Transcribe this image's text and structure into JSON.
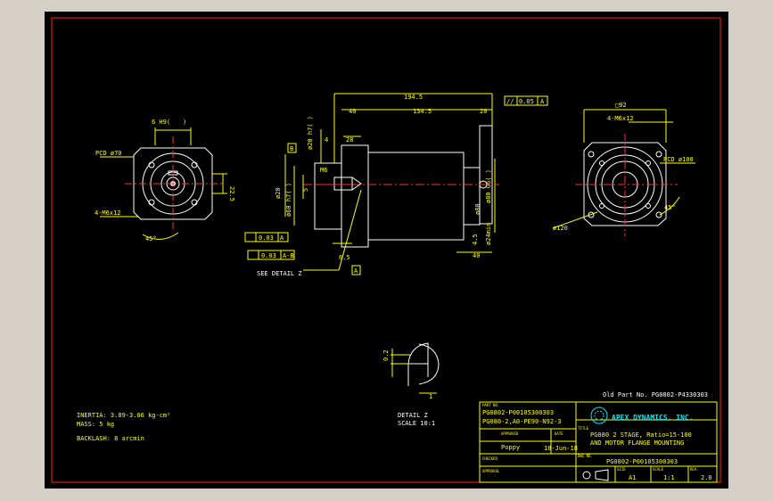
{
  "colors": {
    "background": "#000000",
    "frame": "#ff2020",
    "geometry": "#ffffff",
    "dimension": "#ffff00",
    "center": "#ff3030",
    "accent": "#00e5ff",
    "window": "#d4d0c8"
  },
  "left_view": {
    "keyway": "6 H9(",
    "keyway_b": ")",
    "pcd": "PCD ø70",
    "tap": "4-M6x12",
    "angle": "45°",
    "dim_25": "22.5"
  },
  "mid_view": {
    "len_total": "194.5",
    "len_40": "40",
    "len_134": "134.5",
    "len_20": "20",
    "len_4": "4",
    "len_28": "28",
    "len_65": "6.5",
    "len_40b": "40",
    "shaft_top": "ø20 h7(  )",
    "m6": "M6",
    "flange_60": "ø60 h7(  )",
    "shaft_20": "ø20",
    "d_5": "5",
    "d_80a": "ø80",
    "d_80b": "ø80 G6(  )",
    "d_24": "ø24min",
    "d_415": "4.5",
    "datum_b": "B",
    "datum_a": "A",
    "gdt_par_sym": "//",
    "gdt_par_val": "0.05",
    "gdt_par_ref": "A",
    "gdt_a_val": "0.03",
    "gdt_a_ref": "A",
    "gdt_ab_val": "0.03",
    "gdt_ab_ref": "A-B",
    "see_detail": "SEE DETAIL Z"
  },
  "right_view": {
    "sq": "□92",
    "tap": "4-M6x12",
    "pcd": "PCD ø100",
    "dia": "ø120",
    "angle": "45°"
  },
  "detail": {
    "d02": "0.2",
    "d1": "1",
    "title": "DETAIL Z",
    "scale": "SCALE 10:1"
  },
  "notes": {
    "inertia": "INERTIA: 3.89-3.06 kg-cm²",
    "mass": "MASS: 5 kg",
    "backlash": "BACKLASH: 8 arcmin"
  },
  "old_part": "Old Part No. PG0802-P4330303",
  "title_block": {
    "part_no_label": "PART NO.",
    "part_no_1": "PG0802-P00105300303",
    "part_no_2": "PG080-2,A0-PE90-N92-3",
    "approved_label": "APPROVED",
    "date_label": "DATE",
    "drawn": "Poppy",
    "date": "18-Jun-18",
    "checked_label": "CHECKED",
    "approval_label": "APPROVAL",
    "company": "APEX DYNAMICS, INC.",
    "title_label": "TITLE",
    "title_1": "PG080 2 STAGE, Ratio=15-100",
    "title_2": "AND MOTOR FLANGE MOUNTING",
    "dwg_label": "DWG NO.",
    "dwg_no": "PG0802-P00105300303",
    "size_label": "SIZE",
    "size": "A1",
    "scale_label": "SCALE",
    "scale": "1:1",
    "rev_label": "REV.",
    "rev": "2.0"
  }
}
